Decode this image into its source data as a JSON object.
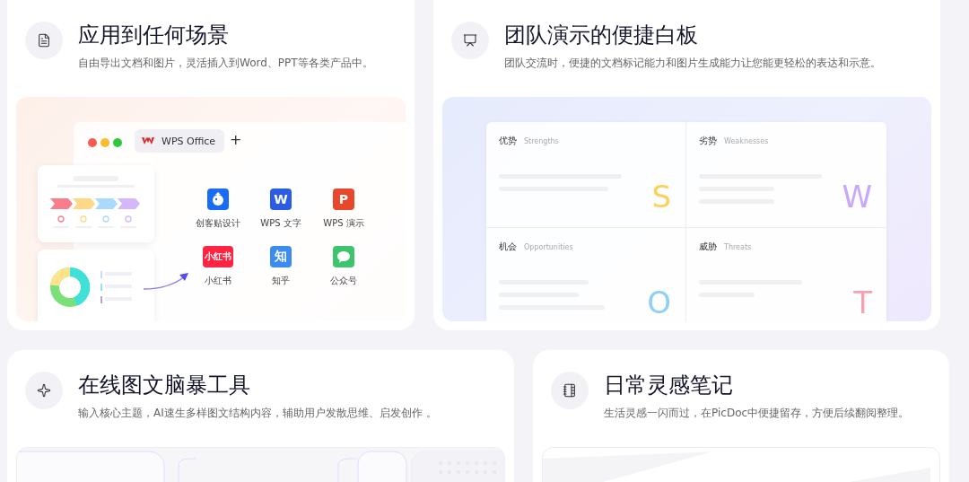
{
  "cards": [
    {
      "title": "应用到任何场景",
      "subtitle": "自由导出文档和图片，灵活插入到Word、PPT等各类产品中。",
      "preview": {
        "kind": "apps",
        "window_tab": "WPS Office",
        "new_tab": "+",
        "apps": [
          {
            "kind": "drawing",
            "label": "创客贴设计",
            "color": "#1a6cf5"
          },
          {
            "kind": "letter",
            "glyph": "W",
            "label": "WPS 文字",
            "color": "#2b5ce6"
          },
          {
            "kind": "letter",
            "glyph": "P",
            "label": "WPS 演示",
            "color": "#e8472b"
          },
          {
            "kind": "letter",
            "glyph": "小红书",
            "label": "小红书",
            "color": "#ff2442"
          },
          {
            "kind": "letter",
            "glyph": "知",
            "label": "知乎",
            "color": "#3b8cf0"
          },
          {
            "kind": "chat",
            "label": "公众号",
            "color": "#3ec46d"
          }
        ]
      }
    },
    {
      "title": "团队演示的便捷白板",
      "subtitle": "团队交流时，便捷的文档标记能力和图片生成能力让您能更轻松的表达和示意。",
      "preview": {
        "kind": "swot",
        "quadrants": [
          {
            "label": "优势",
            "english": "Strengths",
            "letter": "S",
            "color": "#fdd05a"
          },
          {
            "label": "劣势",
            "english": "Weaknesses",
            "letter": "W",
            "color": "#c9a8fb"
          },
          {
            "label": "机会",
            "english": "Opportunities",
            "letter": "O",
            "color": "#8fd0fb"
          },
          {
            "label": "威胁",
            "english": "Threats",
            "letter": "T",
            "color": "#f7a1b0"
          }
        ]
      }
    },
    {
      "title": "在线图文脑暴工具",
      "subtitle": "输入核心主题，AI速生多样图文结构内容，辅助用户发散思维、启发创作 。",
      "preview": {
        "kind": "mindmap"
      }
    },
    {
      "title": "日常灵感笔记",
      "subtitle": "生活灵感一闪而过，在PicDoc中便捷留存，方便后续翻阅整理。",
      "preview": {
        "kind": "note"
      }
    }
  ]
}
